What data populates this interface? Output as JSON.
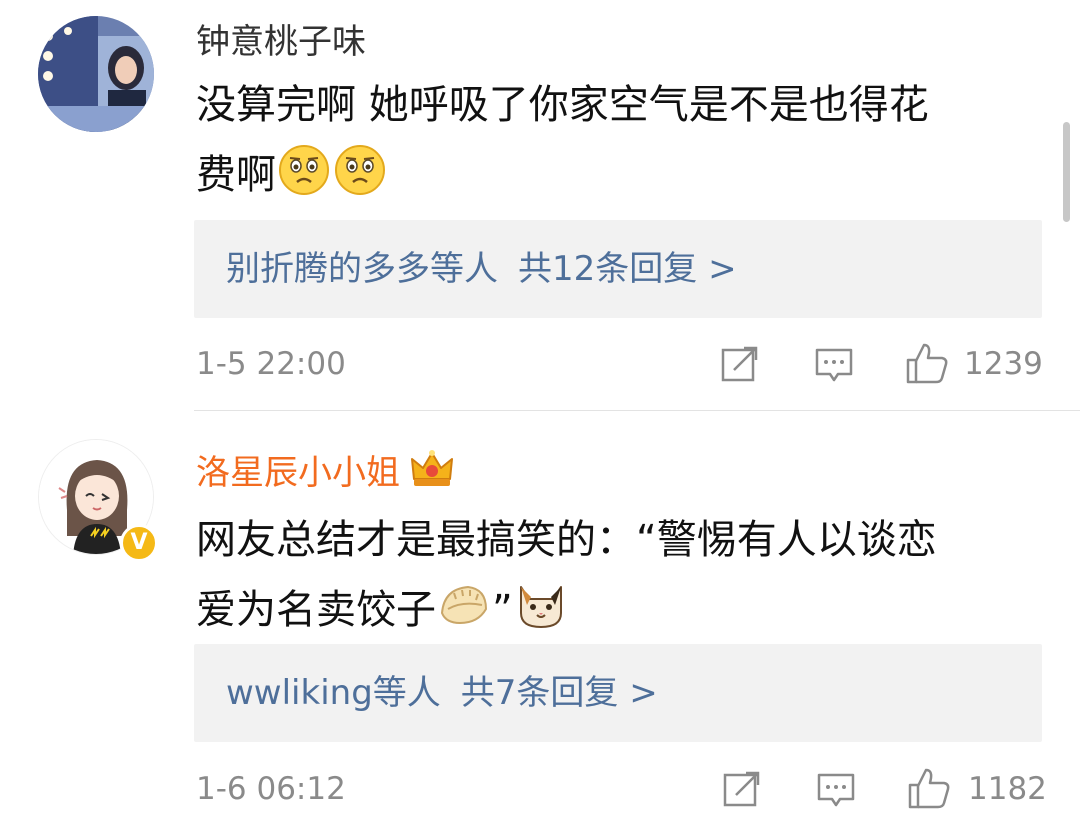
{
  "comments": [
    {
      "username": "钟意桃子味",
      "text_line1": "没算完啊 她呼吸了你家空气是不是也得花",
      "text_line2": "费啊",
      "emojis": [
        "sad-face-emoji",
        "sad-face-emoji"
      ],
      "reply_names": "别折腾的多多等人",
      "reply_count": "共12条回复 >",
      "time": "1-5 22:00",
      "likes": "1239"
    },
    {
      "username": "洛星辰小小姐",
      "user_badge": "crown-icon",
      "verified": "V",
      "text_line1": "网友总结才是最搞笑的：“警惕有人以谈恋",
      "text_line2a": "爱为名卖饺子",
      "text_line2b": "”",
      "emojis": [
        "dumpling-emoji",
        "cat-emoji"
      ],
      "reply_names": "wwliking等人",
      "reply_count": "共7条回复 >",
      "time": "1-6 06:12",
      "likes": "1182"
    }
  ],
  "colors": {
    "link": "#4e6f9a",
    "vip_name": "#f26b1f",
    "meta": "#8a8a8a",
    "reply_bg": "#f2f2f2"
  }
}
